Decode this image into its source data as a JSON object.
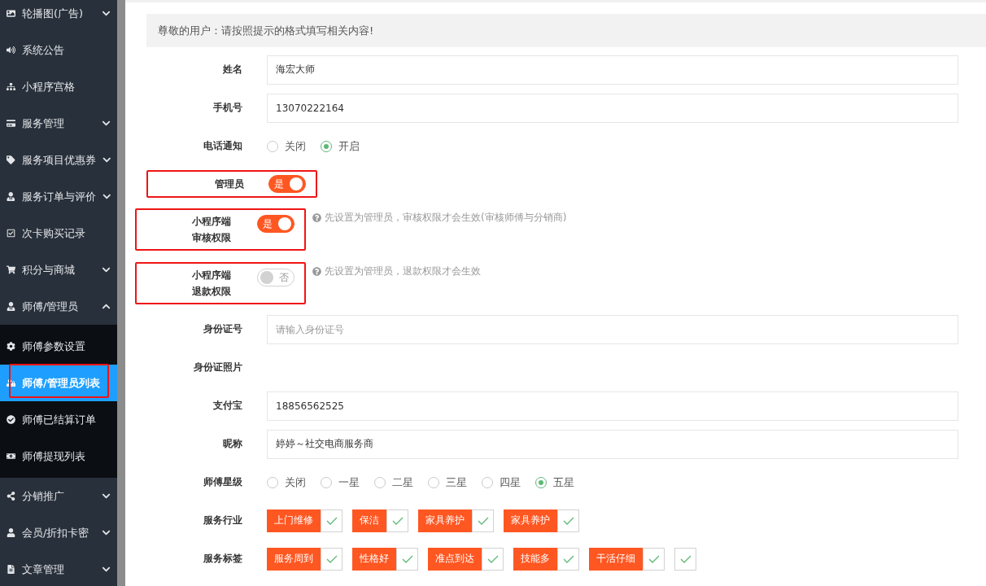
{
  "sidebar": {
    "items": [
      {
        "label": "轮播图(广告)",
        "expanded": false,
        "selected": false
      },
      {
        "label": "系统公告",
        "selected": false
      },
      {
        "label": "小程序宫格",
        "selected": false
      },
      {
        "label": "服务管理",
        "expanded": false,
        "selected": false
      },
      {
        "label": "服务项目优惠券",
        "expanded": false,
        "selected": false
      },
      {
        "label": "服务订单与评价",
        "expanded": false,
        "selected": false
      },
      {
        "label": "次卡购买记录",
        "selected": false
      },
      {
        "label": "积分与商城",
        "expanded": false,
        "selected": false
      },
      {
        "label": "师傅/管理员",
        "expanded": true,
        "selected": false,
        "children": [
          {
            "label": "师傅参数设置",
            "selected": false,
            "highlighted": false
          },
          {
            "label": "师傅/管理员列表",
            "selected": true,
            "highlighted": true
          },
          {
            "label": "师傅已结算订单",
            "selected": false,
            "highlighted": false
          },
          {
            "label": "师傅提现列表",
            "selected": false,
            "highlighted": false
          }
        ]
      },
      {
        "label": "分销推广",
        "expanded": false,
        "selected": false
      },
      {
        "label": "会员/折扣卡密",
        "expanded": false,
        "selected": false
      },
      {
        "label": "文章管理",
        "expanded": false,
        "selected": false
      }
    ]
  },
  "notice": "尊敬的用户：请按照提示的格式填写相关内容!",
  "form": {
    "rows": [
      {
        "kind": "text",
        "label": "姓名",
        "value": "海宏大师"
      },
      {
        "kind": "text",
        "label": "手机号",
        "value": "13070222164"
      },
      {
        "kind": "radio",
        "label": "电话通知",
        "options": [
          {
            "label": "关闭",
            "selected": false
          },
          {
            "label": "开启",
            "selected": true
          }
        ]
      },
      {
        "kind": "switch",
        "label": "管理员",
        "on": true,
        "text": "是",
        "highlighted": true
      },
      {
        "kind": "switch",
        "label": "小程序端审核权限",
        "on": true,
        "text": "是",
        "highlighted": true,
        "hint": "先设置为管理员，审核权限才会生效(审核师傅与分销商)"
      },
      {
        "kind": "switch",
        "label": "小程序端退款权限",
        "on": false,
        "text": "否",
        "highlighted": true,
        "hint": "先设置为管理员，退款权限才会生效"
      },
      {
        "kind": "text",
        "label": "身份证号",
        "placeholder": "请输入身份证号"
      },
      {
        "kind": "none",
        "label": "身份证照片"
      },
      {
        "kind": "text",
        "label": "支付宝",
        "value": "18856562525"
      },
      {
        "kind": "text",
        "label": "昵称",
        "value": "婷婷～社交电商服务商"
      },
      {
        "kind": "radio",
        "label": "师傅星级",
        "options": [
          {
            "label": "关闭",
            "selected": false
          },
          {
            "label": "一星",
            "selected": false
          },
          {
            "label": "二星",
            "selected": false
          },
          {
            "label": "三星",
            "selected": false
          },
          {
            "label": "四星",
            "selected": false
          },
          {
            "label": "五星",
            "selected": true
          }
        ]
      },
      {
        "kind": "tags",
        "label": "服务行业",
        "tags": [
          {
            "label": "上门维修",
            "checked": true
          },
          {
            "label": "保洁",
            "checked": true
          },
          {
            "label": "家具养护",
            "checked": true
          },
          {
            "label": "家具养护",
            "checked": true
          }
        ]
      },
      {
        "kind": "tags",
        "label": "服务标签",
        "tags": [
          {
            "label": "服务周到",
            "checked": true
          },
          {
            "label": "性格好",
            "checked": true
          },
          {
            "label": "准点到达",
            "checked": true
          },
          {
            "label": "技能多",
            "checked": true
          },
          {
            "label": "干活仔细",
            "checked": true
          },
          {
            "checked": true
          }
        ]
      }
    ]
  }
}
